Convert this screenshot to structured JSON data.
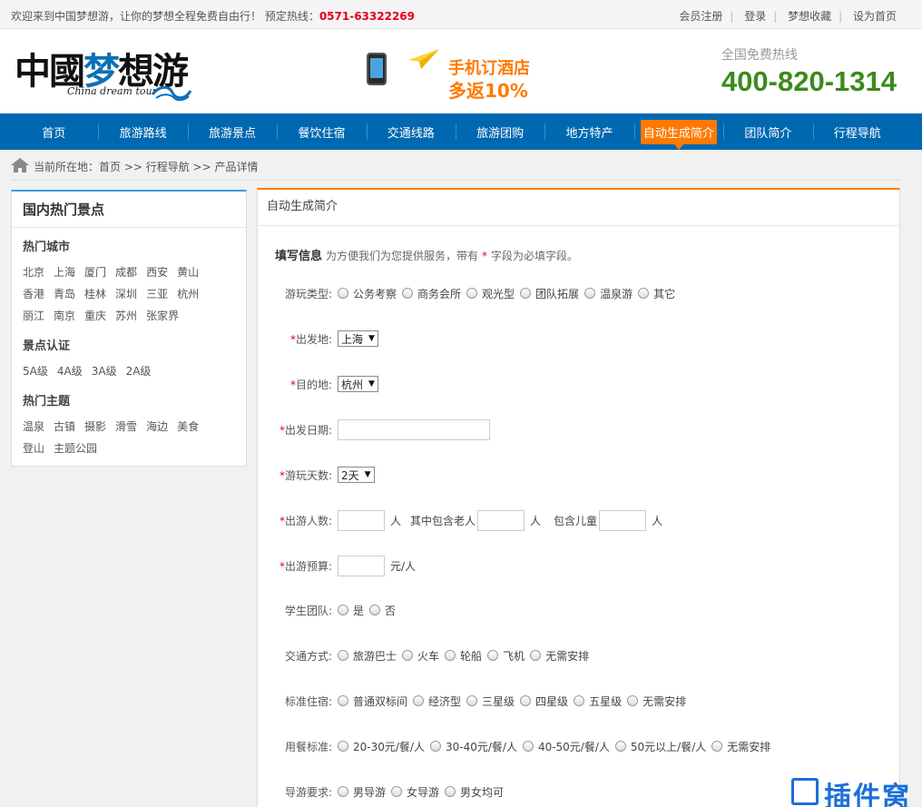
{
  "topbar": {
    "welcome": "欢迎来到中国梦想游，让你的梦想全程免费自由行！ 预定热线：",
    "hotline": "0571-63322269",
    "links": [
      "会员注册",
      "登录",
      "梦想收藏",
      "设为首页"
    ]
  },
  "header": {
    "logo_cn": "中國梦想游",
    "logo_en": "China dream tour",
    "promo_line1": "手机订酒店",
    "promo_line2": "多返10%",
    "hotline_label": "全国免费热线",
    "hotline_number": "400-820-1314"
  },
  "nav": {
    "items": [
      "首页",
      "旅游路线",
      "旅游景点",
      "餐饮住宿",
      "交通线路",
      "旅游团购",
      "地方特产",
      "自动生成简介",
      "团队简介",
      "行程导航"
    ],
    "active": "自动生成简介"
  },
  "breadcrumb": "当前所在地：首页 >> 行程导航 >> 产品详情",
  "sidebar": {
    "title": "国内热门景点",
    "sections": [
      {
        "title": "热门城市",
        "tags": [
          "北京",
          "上海",
          "厦门",
          "成都",
          "西安",
          "黄山",
          "香港",
          "青岛",
          "桂林",
          "深圳",
          "三亚",
          "杭州",
          "丽江",
          "南京",
          "重庆",
          "苏州",
          "张家界"
        ]
      },
      {
        "title": "景点认证",
        "tags": [
          "5A级",
          "4A级",
          "3A级",
          "2A级"
        ]
      },
      {
        "title": "热门主题",
        "tags": [
          "温泉",
          "古镇",
          "摄影",
          "滑雪",
          "海边",
          "美食",
          "登山",
          "主题公园"
        ]
      }
    ]
  },
  "main": {
    "title": "自动生成简介",
    "form_head_big": "填写信息",
    "form_head_small1": "为方便我们为您提供服务，带有",
    "form_head_star": "*",
    "form_head_small2": "字段为必填字段。",
    "play_type": {
      "label": "游玩类型:",
      "options": [
        "公务考察",
        "商务会所",
        "观光型",
        "团队拓展",
        "温泉游",
        "其它"
      ]
    },
    "departure": {
      "label": "出发地:",
      "value": "上海"
    },
    "destination": {
      "label": "目的地:",
      "value": "杭州"
    },
    "date": {
      "label": "出发日期:",
      "value": ""
    },
    "days": {
      "label": "游玩天数:",
      "value": "2天"
    },
    "people": {
      "label": "出游人数:",
      "unit": "人",
      "elder_label": "其中包含老人",
      "child_label": "包含儿童"
    },
    "budget": {
      "label": "出游预算:",
      "unit": "元/人"
    },
    "student": {
      "label": "学生团队:",
      "options": [
        "是",
        "否"
      ]
    },
    "transport": {
      "label": "交通方式:",
      "options": [
        "旅游巴士",
        "火车",
        "轮船",
        "飞机",
        "无需安排"
      ]
    },
    "hotel": {
      "label": "标准住宿:",
      "options": [
        "普通双标间",
        "经济型",
        "三星级",
        "四星级",
        "五星级",
        "无需安排"
      ]
    },
    "meal": {
      "label": "用餐标准:",
      "options": [
        "20-30元/餐/人",
        "30-40元/餐/人",
        "40-50元/餐/人",
        "50元以上/餐/人",
        "无需安排"
      ]
    },
    "guide": {
      "label": "导游要求:",
      "options": [
        "男导游",
        "女导游",
        "男女均可"
      ]
    }
  },
  "watermark": "插件窝",
  "colors": {
    "nav_bg": "#0068b0",
    "accent_orange": "#ff7a00",
    "hotline_green": "#3a8b1b",
    "red": "#e1001a"
  }
}
